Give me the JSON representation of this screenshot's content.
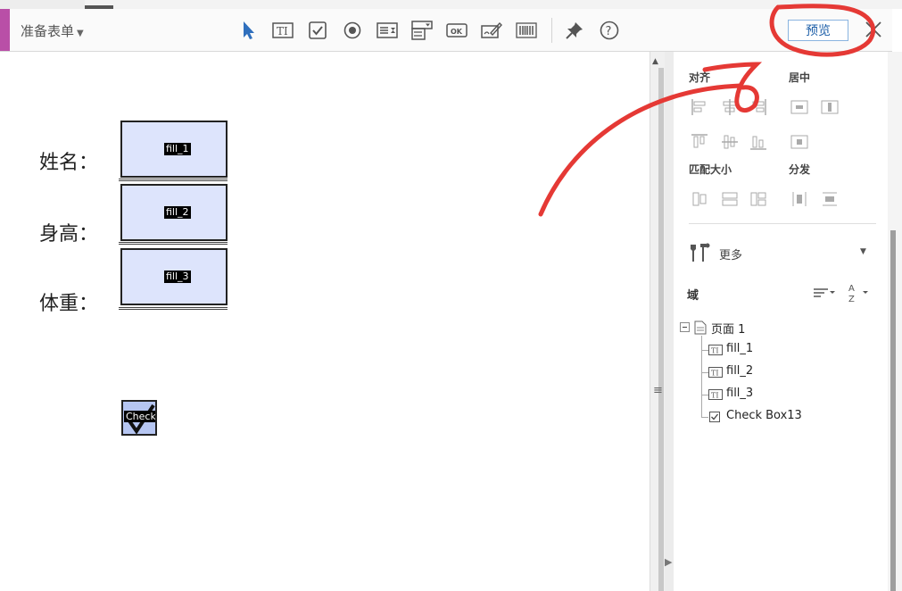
{
  "toolbar": {
    "mode_label": "准备表单",
    "preview_label": "预览",
    "tools": [
      "select-tool",
      "text-field-tool",
      "checkbox-tool",
      "radio-button-tool",
      "list-box-tool",
      "dropdown-tool",
      "button-tool",
      "signature-tool",
      "barcode-tool",
      "pin-tool",
      "help-tool"
    ]
  },
  "document": {
    "labels": [
      "姓名：",
      "身高：",
      "体重："
    ],
    "fields": [
      "fill_1",
      "fill_2",
      "fill_3"
    ],
    "checkbox_tag": "Check"
  },
  "panel": {
    "align_title": "对齐",
    "center_title": "居中",
    "match_size_title": "匹配大小",
    "distribute_title": "分发",
    "more_label": "更多",
    "fields_title": "域",
    "tree": {
      "page": "页面 1",
      "items": [
        "fill_1",
        "fill_2",
        "fill_3",
        "Check Box13"
      ]
    }
  },
  "colors": {
    "accent": "#b94fa7",
    "field_fill": "#dde4fc",
    "annotation": "#e53935",
    "preview_text": "#1d5fa8"
  }
}
